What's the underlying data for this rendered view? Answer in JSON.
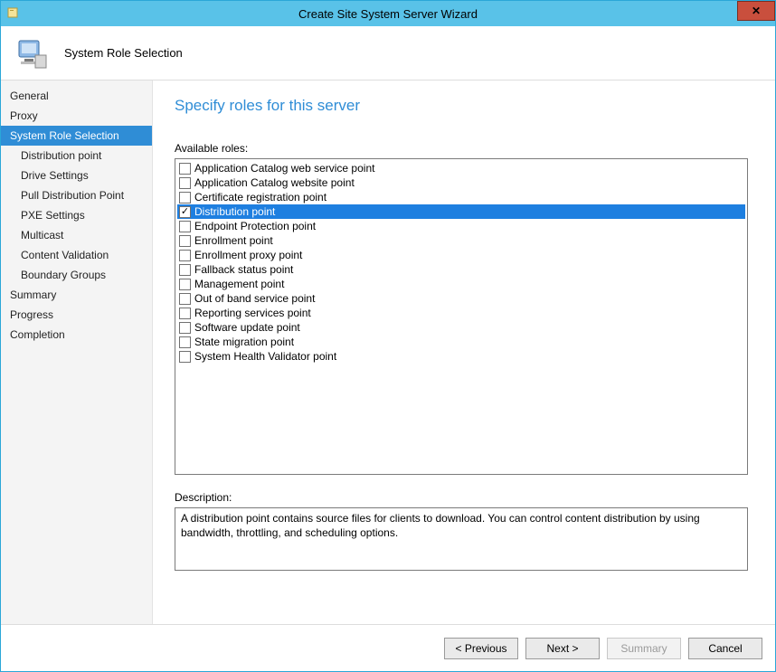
{
  "window": {
    "title": "Create Site System Server Wizard",
    "close_label": "×"
  },
  "header": {
    "label": "System Role Selection"
  },
  "sidebar": {
    "items": [
      {
        "label": "General",
        "sub": false,
        "selected": false
      },
      {
        "label": "Proxy",
        "sub": false,
        "selected": false
      },
      {
        "label": "System Role Selection",
        "sub": false,
        "selected": true
      },
      {
        "label": "Distribution point",
        "sub": true,
        "selected": false
      },
      {
        "label": "Drive Settings",
        "sub": true,
        "selected": false
      },
      {
        "label": "Pull Distribution Point",
        "sub": true,
        "selected": false
      },
      {
        "label": "PXE Settings",
        "sub": true,
        "selected": false
      },
      {
        "label": "Multicast",
        "sub": true,
        "selected": false
      },
      {
        "label": "Content Validation",
        "sub": true,
        "selected": false
      },
      {
        "label": "Boundary Groups",
        "sub": true,
        "selected": false
      },
      {
        "label": "Summary",
        "sub": false,
        "selected": false
      },
      {
        "label": "Progress",
        "sub": false,
        "selected": false
      },
      {
        "label": "Completion",
        "sub": false,
        "selected": false
      }
    ]
  },
  "main": {
    "heading": "Specify roles for this server",
    "available_label": "Available roles:",
    "roles": [
      {
        "label": "Application Catalog web service point",
        "checked": false,
        "selected": false
      },
      {
        "label": "Application Catalog website point",
        "checked": false,
        "selected": false
      },
      {
        "label": "Certificate registration point",
        "checked": false,
        "selected": false
      },
      {
        "label": "Distribution point",
        "checked": true,
        "selected": true
      },
      {
        "label": "Endpoint Protection point",
        "checked": false,
        "selected": false
      },
      {
        "label": "Enrollment point",
        "checked": false,
        "selected": false
      },
      {
        "label": "Enrollment proxy point",
        "checked": false,
        "selected": false
      },
      {
        "label": "Fallback status point",
        "checked": false,
        "selected": false
      },
      {
        "label": "Management point",
        "checked": false,
        "selected": false
      },
      {
        "label": "Out of band service point",
        "checked": false,
        "selected": false
      },
      {
        "label": "Reporting services point",
        "checked": false,
        "selected": false
      },
      {
        "label": "Software update point",
        "checked": false,
        "selected": false
      },
      {
        "label": "State migration point",
        "checked": false,
        "selected": false
      },
      {
        "label": "System Health Validator point",
        "checked": false,
        "selected": false
      }
    ],
    "description_label": "Description:",
    "description_text": "A distribution point contains source files for clients to download. You can control content distribution by using bandwidth, throttling, and scheduling options."
  },
  "footer": {
    "previous": "< Previous",
    "next": "Next >",
    "summary": "Summary",
    "cancel": "Cancel"
  }
}
